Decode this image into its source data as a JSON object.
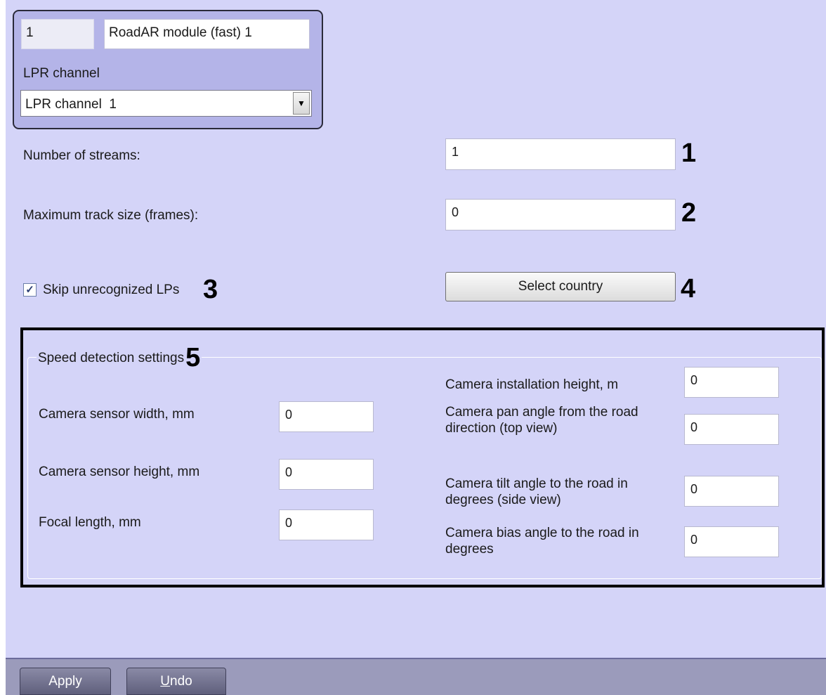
{
  "object": {
    "id_value": "1",
    "name_value": "RoadAR module (fast) 1",
    "parent_label": "LPR channel",
    "parent_selected": "LPR channel  1"
  },
  "settings": {
    "streams_label": "Number of streams:",
    "streams_value": "1",
    "track_label": "Maximum track size (frames):",
    "track_value": "0",
    "skip_label": "Skip unrecognized LPs",
    "skip_checked": true,
    "country_button": "Select country"
  },
  "speed": {
    "title": "Speed detection settings",
    "sensor_width_label": "Camera sensor width, mm",
    "sensor_width_value": "0",
    "sensor_height_label": "Camera sensor height, mm",
    "sensor_height_value": "0",
    "focal_label": "Focal length, mm",
    "focal_value": "0",
    "install_height_label": "Camera installation height, m",
    "install_height_value": "0",
    "pan_label": "Camera pan angle from the road direction (top view)",
    "pan_value": "0",
    "tilt_label": "Camera tilt angle to the road in degrees (side view)",
    "tilt_value": "0",
    "bias_label": "Camera bias angle to the road in degrees",
    "bias_value": "0"
  },
  "markers": [
    "1",
    "2",
    "3",
    "4",
    "5"
  ],
  "footer": {
    "apply_label": "Apply",
    "undo_label_first": "U",
    "undo_label_rest": "ndo"
  },
  "colors": {
    "panel_bg": "#d4d4f8",
    "context_bg": "#b4b4e8",
    "footer_bg": "#9b9bbb",
    "highlight_border": "#000000"
  }
}
